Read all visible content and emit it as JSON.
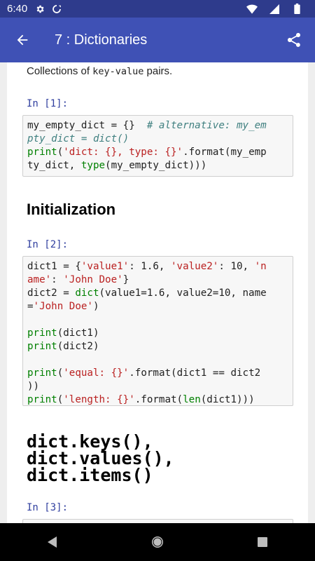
{
  "status_bar": {
    "time": "6:40",
    "icons": [
      "gear-icon",
      "auto-rotate-icon",
      "wifi-icon",
      "signal-icon",
      "battery-icon"
    ]
  },
  "app_bar": {
    "title": "7 : Dictionaries",
    "icons": [
      "back-arrow-icon",
      "share-icon"
    ]
  },
  "content": {
    "intro_prefix": "Collections of ",
    "intro_code": "key-value",
    "intro_suffix": " pairs.",
    "cells": [
      {
        "prompt": "In [1]:",
        "lines": [
          [
            {
              "t": "my_empty_dict = {}  ",
              "c": ""
            },
            {
              "t": "# alternative: my_em",
              "c": "cmt"
            }
          ],
          [
            {
              "t": "pty_dict = dict()",
              "c": "cmt"
            }
          ],
          [
            {
              "t": "print",
              "c": "kw"
            },
            {
              "t": "(",
              "c": ""
            },
            {
              "t": "'dict: {}, type: {}'",
              "c": "str"
            },
            {
              "t": ".format(my_emp",
              "c": ""
            }
          ],
          [
            {
              "t": "ty_dict, ",
              "c": ""
            },
            {
              "t": "type",
              "c": "kw"
            },
            {
              "t": "(my_empty_dict)))",
              "c": ""
            }
          ]
        ]
      },
      {
        "prompt": "In [2]:",
        "lines": [
          [
            {
              "t": "dict1 = {",
              "c": ""
            },
            {
              "t": "'value1'",
              "c": "str"
            },
            {
              "t": ": 1.6, ",
              "c": ""
            },
            {
              "t": "'value2'",
              "c": "str"
            },
            {
              "t": ": 10, ",
              "c": ""
            },
            {
              "t": "'n",
              "c": "str"
            }
          ],
          [
            {
              "t": "ame'",
              "c": "str"
            },
            {
              "t": ": ",
              "c": ""
            },
            {
              "t": "'John Doe'",
              "c": "str"
            },
            {
              "t": "}",
              "c": ""
            }
          ],
          [
            {
              "t": "dict2 = ",
              "c": ""
            },
            {
              "t": "dict",
              "c": "kw"
            },
            {
              "t": "(value1=1.6, value2=10, name",
              "c": ""
            }
          ],
          [
            {
              "t": "=",
              "c": ""
            },
            {
              "t": "'John Doe'",
              "c": "str"
            },
            {
              "t": ")",
              "c": ""
            }
          ],
          [
            {
              "t": "",
              "c": ""
            }
          ],
          [
            {
              "t": "print",
              "c": "kw"
            },
            {
              "t": "(dict1)",
              "c": ""
            }
          ],
          [
            {
              "t": "print",
              "c": "kw"
            },
            {
              "t": "(dict2)",
              "c": ""
            }
          ],
          [
            {
              "t": "",
              "c": ""
            }
          ],
          [
            {
              "t": "print",
              "c": "kw"
            },
            {
              "t": "(",
              "c": ""
            },
            {
              "t": "'equal: {}'",
              "c": "str"
            },
            {
              "t": ".format(dict1 == dict2",
              "c": ""
            }
          ],
          [
            {
              "t": "))",
              "c": ""
            }
          ],
          [
            {
              "t": "print",
              "c": "kw"
            },
            {
              "t": "(",
              "c": ""
            },
            {
              "t": "'length: {}'",
              "c": "str"
            },
            {
              "t": ".format(",
              "c": ""
            },
            {
              "t": "len",
              "c": "kw"
            },
            {
              "t": "(dict1)))",
              "c": ""
            }
          ]
        ]
      },
      {
        "prompt": "In [3]:",
        "lines": []
      }
    ],
    "heading_initialization": "Initialization",
    "heading_methods": [
      "dict.keys(),",
      "dict.values(),",
      "dict.items()"
    ]
  },
  "nav_bar": {
    "icons": [
      "back-triangle-icon",
      "home-circle-icon",
      "recents-square-icon"
    ]
  },
  "colors": {
    "status_bar": "#2e3b8c",
    "app_bar": "#3f51b5",
    "prompt": "#303f9f",
    "keyword": "#008000",
    "string": "#ba2121",
    "comment": "#408080"
  }
}
